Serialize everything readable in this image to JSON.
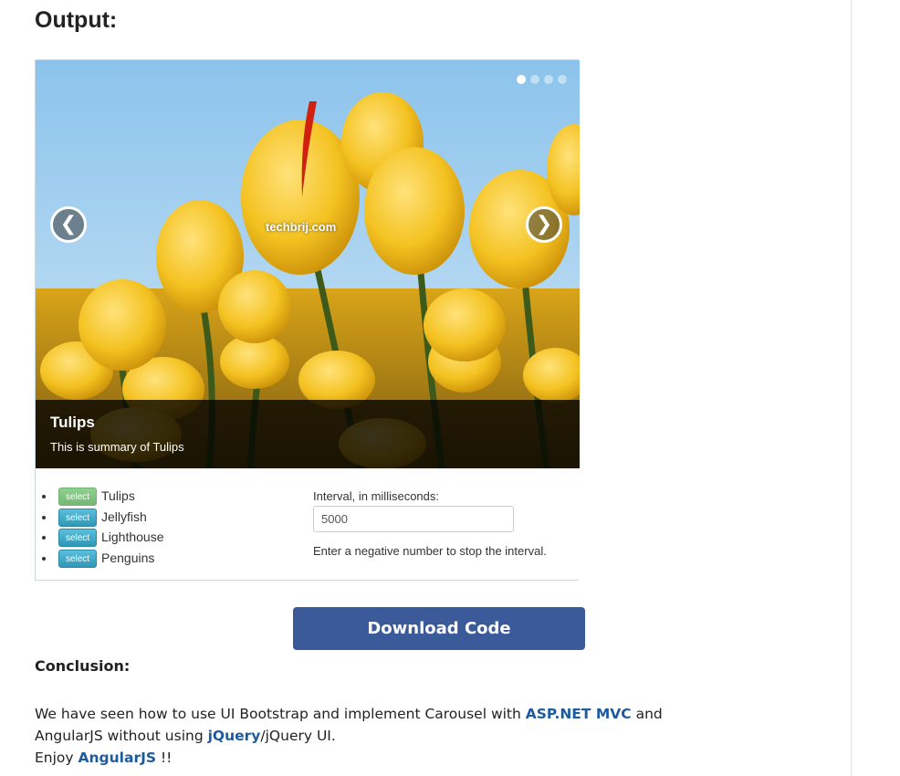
{
  "section_heading": "Output:",
  "carousel": {
    "watermark": "techbrij.com",
    "prev_glyph": "❮",
    "next_glyph": "❯",
    "caption_title": "Tulips",
    "caption_text": "This is summary of Tulips",
    "indicator_count": 4,
    "active_index": 0
  },
  "slides": [
    {
      "button_label": "select",
      "name": "Tulips",
      "active": true
    },
    {
      "button_label": "select",
      "name": "Jellyfish",
      "active": false
    },
    {
      "button_label": "select",
      "name": "Lighthouse",
      "active": false
    },
    {
      "button_label": "select",
      "name": "Penguins",
      "active": false
    }
  ],
  "interval": {
    "label": "Interval, in milliseconds:",
    "value": "5000",
    "help": "Enter a negative number to stop the interval."
  },
  "download_button": "Download Code",
  "conclusion": {
    "title": "Conclusion:",
    "line1_before": "We have seen how to use UI Bootstrap and implement Carousel with ",
    "link_aspnet": "ASP.NET MVC",
    "line1_after": " and",
    "line2_before": "AngularJS without using ",
    "link_jquery": "jQuery",
    "line2_after": "/jQuery UI.",
    "line3_before": "Enjoy ",
    "link_angular": "AngularJS",
    "line3_after": " !!"
  },
  "colors": {
    "accent_blue": "#3b5a99",
    "link": "#1e5b9e",
    "info_button": "#2f96b4",
    "success_button": "#75b775"
  }
}
